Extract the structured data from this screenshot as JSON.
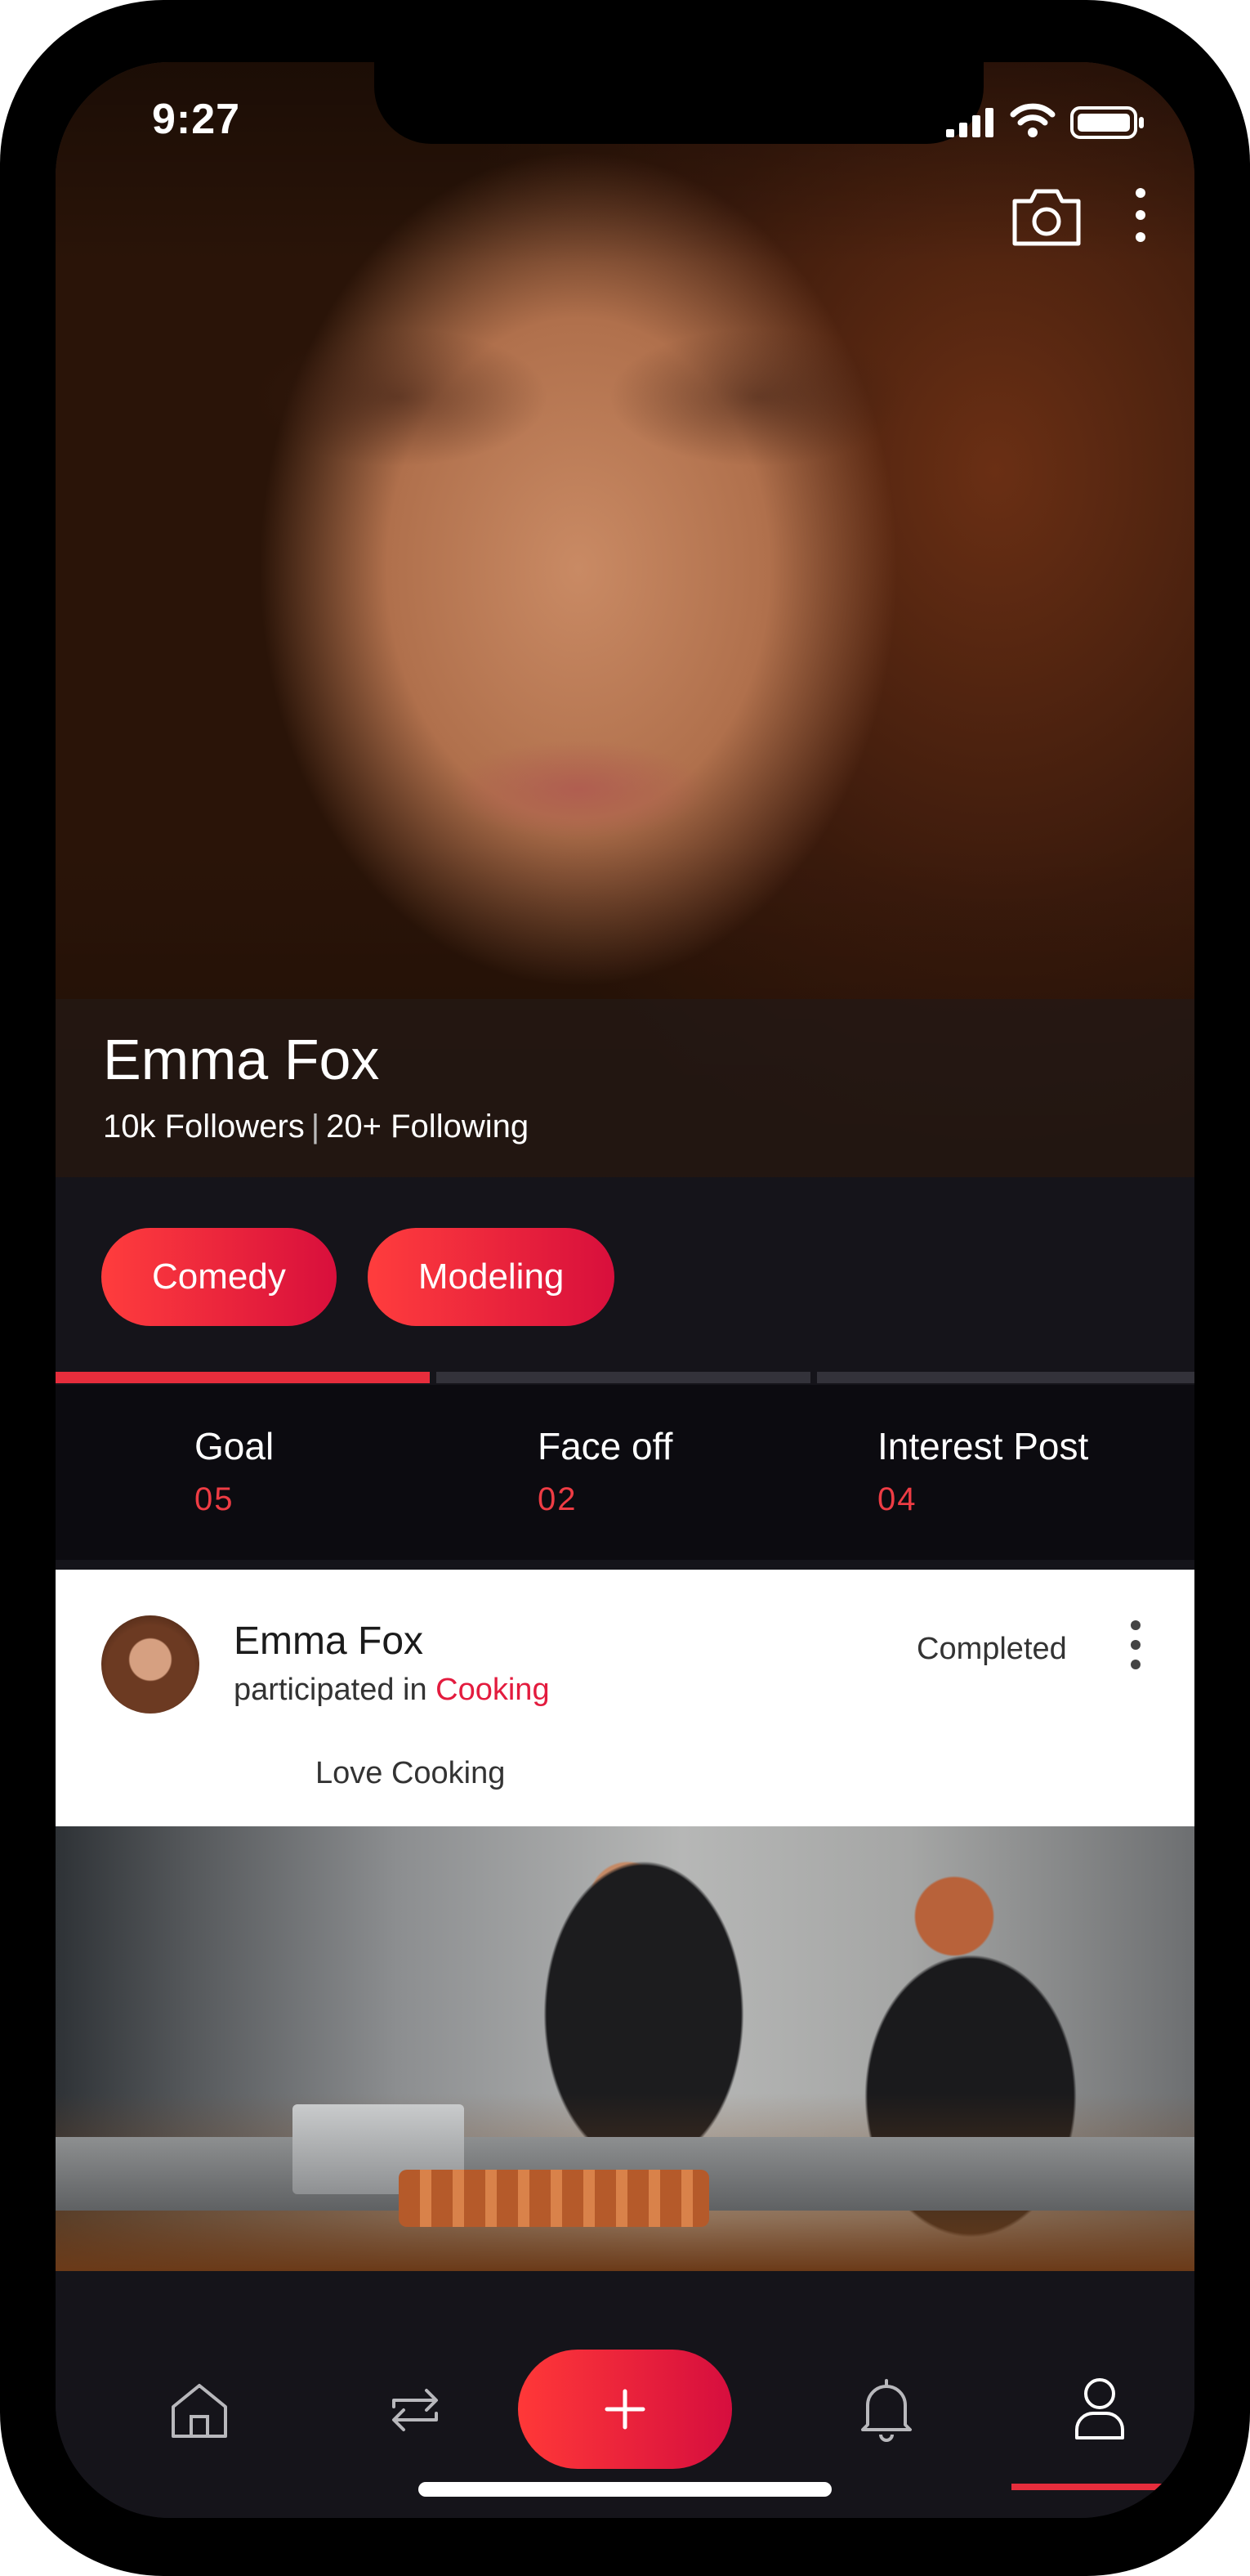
{
  "status_bar": {
    "time": "9:27",
    "icons": [
      "signal-icon",
      "wifi-icon",
      "battery-icon"
    ]
  },
  "header": {
    "actions": [
      "camera-icon",
      "more-vertical-icon"
    ]
  },
  "profile": {
    "name": "Emma Fox",
    "followers": "10k Followers",
    "separator": "|",
    "following": "20+ Following"
  },
  "interests": [
    "Comedy",
    "Modeling"
  ],
  "tabs": {
    "active_index": 0,
    "items": [
      {
        "label": "Goal",
        "value": "05"
      },
      {
        "label": "Face off",
        "value": "02"
      },
      {
        "label": "Interest Post",
        "value": "04"
      }
    ]
  },
  "post": {
    "author": "Emma Fox",
    "action_text": "participated in",
    "category": "Cooking",
    "status": "Completed",
    "caption": "Love Cooking",
    "image": "kitchen-chefs-photo"
  },
  "bottom_nav": {
    "items": [
      "home-icon",
      "repeat-icon",
      "add-icon",
      "bell-icon",
      "user-icon"
    ],
    "active": "user-icon"
  },
  "colors": {
    "accent": "#e62d3c",
    "accent_gradient_start": "#ff3d3d",
    "accent_gradient_end": "#d80f3c",
    "background": "#15141a",
    "link": "#e31b3e"
  }
}
